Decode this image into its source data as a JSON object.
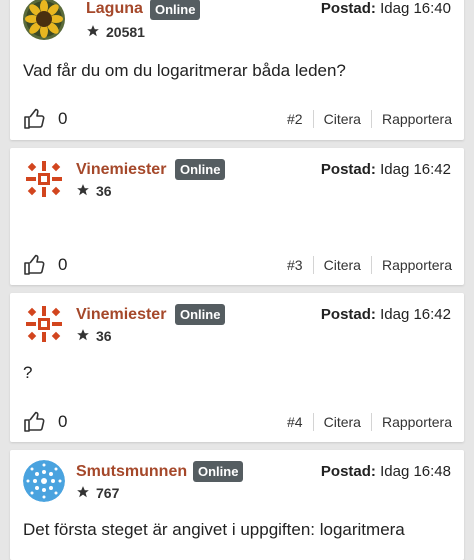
{
  "posts": [
    {
      "user": "Laguna",
      "status": "Online",
      "rating": "20581",
      "meta_label": "Postad:",
      "meta_time": "Idag 16:40",
      "body": "Vad får du om du logaritmerar båda leden?",
      "likes": "0",
      "number": "#2",
      "quote_label": "Citera",
      "report_label": "Rapportera",
      "avatar_icon": "sunflower-avatar"
    },
    {
      "user": "Vinemiester",
      "status": "Online",
      "rating": "36",
      "meta_label": "Postad:",
      "meta_time": "Idag 16:42",
      "body": "",
      "likes": "0",
      "number": "#3",
      "quote_label": "Citera",
      "report_label": "Rapportera",
      "avatar_icon": "red-pattern-avatar"
    },
    {
      "user": "Vinemiester",
      "status": "Online",
      "rating": "36",
      "meta_label": "Postad:",
      "meta_time": "Idag 16:42",
      "body": "?",
      "likes": "0",
      "number": "#4",
      "quote_label": "Citera",
      "report_label": "Rapportera",
      "avatar_icon": "red-pattern-avatar"
    },
    {
      "user": "Smutsmunnen",
      "status": "Online",
      "rating": "767",
      "meta_label": "Postad:",
      "meta_time": "Idag 16:48",
      "body": "Det första steget är angivet i uppgiften: logaritmera",
      "likes": "",
      "number": "",
      "quote_label": "",
      "report_label": "",
      "avatar_icon": "blue-pattern-avatar"
    }
  ],
  "colors": {
    "username": "#a5482a",
    "badge": "#555d61",
    "background": "#e6e6e6"
  }
}
